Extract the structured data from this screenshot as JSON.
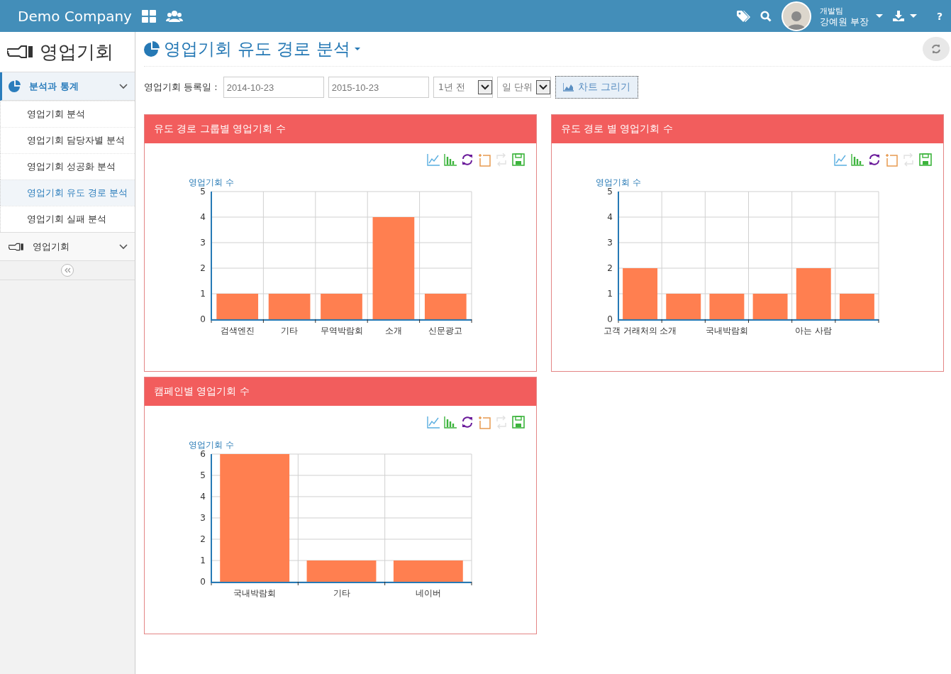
{
  "topbar": {
    "brand": "Demo Company",
    "user": {
      "team": "개발팀",
      "name": "강예원 부장"
    },
    "help": "?"
  },
  "sidebar": {
    "title": "영업기회",
    "sections": [
      {
        "label": "분석과 통계",
        "kind": "pie",
        "expanded": true,
        "active": true,
        "children": [
          {
            "label": "영업기회 분석",
            "selected": false
          },
          {
            "label": "영업기회 담당자별 분석",
            "selected": false
          },
          {
            "label": "영업기회 성공화 분석",
            "selected": false
          },
          {
            "label": "영업기회 유도 경로 분석",
            "selected": true
          },
          {
            "label": "영업기회 실패 분석",
            "selected": false
          }
        ]
      },
      {
        "label": "영업기회",
        "kind": "hand",
        "expanded": false,
        "active": false
      }
    ]
  },
  "page": {
    "title": "영업기회 유도 경로 분석"
  },
  "filter": {
    "label": "영업기회 등록일 :",
    "from": "2014-10-23",
    "to": "2015-10-23",
    "range": "1년 전",
    "unit": "일 단위",
    "button": "차트 그리기"
  },
  "panels": [
    {
      "title": "유도 경로 그룹별 영업기회 수",
      "tools": [
        {
          "kind": "line",
          "disabled": false
        },
        {
          "kind": "bar",
          "disabled": false
        },
        {
          "kind": "refresh",
          "disabled": false
        },
        {
          "kind": "crop",
          "disabled": false
        },
        {
          "kind": "swap",
          "disabled": true
        },
        {
          "kind": "save",
          "disabled": false
        }
      ],
      "chart_data": {
        "type": "bar",
        "ylabel": "영업기회 수",
        "grid": true,
        "categories": [
          "검색엔진",
          "기타",
          "무역박람회",
          "소개",
          "신문광고"
        ],
        "series": [
          {
            "color": "#ff7f50",
            "values": [
              1,
              1,
              1,
              4,
              1
            ]
          }
        ],
        "ylim": [
          0,
          5
        ],
        "yticks": [
          0,
          1,
          2,
          3,
          4,
          5
        ]
      }
    },
    {
      "title": "유도 경로 별 영업기회 수",
      "tools": [
        {
          "kind": "line",
          "disabled": false
        },
        {
          "kind": "bar",
          "disabled": false
        },
        {
          "kind": "refresh",
          "disabled": false
        },
        {
          "kind": "crop",
          "disabled": false
        },
        {
          "kind": "swap",
          "disabled": true
        },
        {
          "kind": "save",
          "disabled": false
        }
      ],
      "chart_data": {
        "type": "bar",
        "ylabel": "영업기회 수",
        "grid": true,
        "categories": [
          "고객 거래처의 소개",
          null,
          "국내박람회",
          null,
          "아는 사람",
          null
        ],
        "series": [
          {
            "color": "#ff7f50",
            "values": [
              2,
              1,
              1,
              1,
              2,
              1
            ]
          }
        ],
        "ylim": [
          0,
          5
        ],
        "yticks": [
          0,
          1,
          2,
          3,
          4,
          5
        ]
      }
    },
    {
      "title": "캠페인별 영업기회 수",
      "tools": [
        {
          "kind": "line",
          "disabled": false
        },
        {
          "kind": "bar",
          "disabled": false
        },
        {
          "kind": "refresh",
          "disabled": false
        },
        {
          "kind": "crop",
          "disabled": false
        },
        {
          "kind": "swap",
          "disabled": true
        },
        {
          "kind": "save",
          "disabled": false
        }
      ],
      "chart_data": {
        "type": "bar",
        "ylabel": "영업기회 수",
        "grid": true,
        "categories": [
          "국내박람회",
          "기타",
          "네이버"
        ],
        "series": [
          {
            "color": "#ff7f50",
            "values": [
              6,
              1,
              1
            ]
          }
        ],
        "ylim": [
          0,
          6
        ],
        "yticks": [
          0,
          1,
          2,
          3,
          4,
          5,
          6
        ]
      }
    }
  ]
}
